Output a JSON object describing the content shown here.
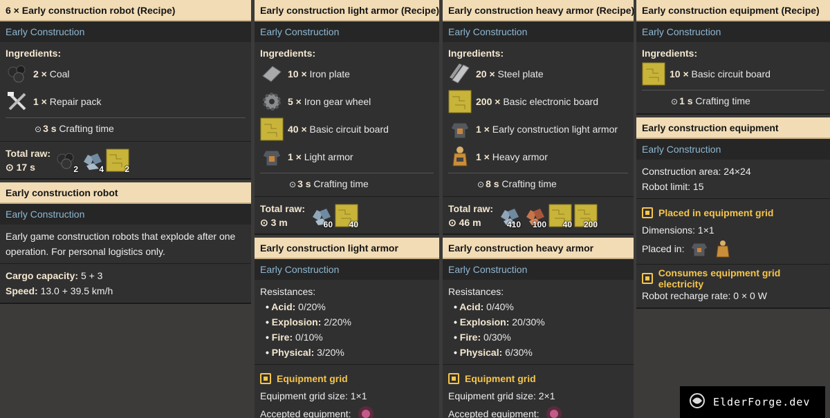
{
  "c1": {
    "recipe_title": "6 × Early construction robot (Recipe)",
    "group": "Early Construction",
    "ingredients_label": "Ingredients:",
    "ingredients": [
      {
        "amount": "2 ×",
        "name": "Coal",
        "icon": "coal-icon"
      },
      {
        "amount": "1 ×",
        "name": "Repair pack",
        "icon": "repair-pack-icon"
      }
    ],
    "time_value": "3 s",
    "time_label": "Crafting time",
    "total_raw_label": "Total raw:",
    "total_time": "17 s",
    "raw": [
      {
        "count": "2",
        "icon": "coal-icon"
      },
      {
        "count": "4",
        "icon": "iron-ore-icon"
      },
      {
        "count": "2",
        "icon": "circuit-board-icon"
      }
    ],
    "item_title": "Early construction robot",
    "item_group": "Early Construction",
    "description": "Early game construction robots that explode after one operation. For personal logistics only.",
    "cargo_label": "Cargo capacity:",
    "cargo_value": "5 + 3",
    "speed_label": "Speed:",
    "speed_value": "13.0 + 39.5  km/h"
  },
  "c2": {
    "recipe_title": "Early construction light armor (Recipe)",
    "group": "Early Construction",
    "ingredients_label": "Ingredients:",
    "ingredients": [
      {
        "amount": "10 ×",
        "name": "Iron plate",
        "icon": "iron-plate-icon"
      },
      {
        "amount": "5 ×",
        "name": "Iron gear wheel",
        "icon": "gear-icon"
      },
      {
        "amount": "40 ×",
        "name": "Basic circuit board",
        "icon": "circuit-board-icon"
      },
      {
        "amount": "1 ×",
        "name": "Light armor",
        "icon": "light-armor-icon"
      }
    ],
    "time_value": "3 s",
    "time_label": "Crafting time",
    "total_raw_label": "Total raw:",
    "total_time": "3 m",
    "raw": [
      {
        "count": "60",
        "icon": "iron-ore-icon"
      },
      {
        "count": "40",
        "icon": "circuit-board-icon"
      }
    ],
    "item_title": "Early construction light armor",
    "item_group": "Early Construction",
    "resist_label": "Resistances:",
    "resist": [
      {
        "k": "Acid:",
        "v": "0/20%"
      },
      {
        "k": "Explosion:",
        "v": "2/20%"
      },
      {
        "k": "Fire:",
        "v": "0/10%"
      },
      {
        "k": "Physical:",
        "v": "3/20%"
      }
    ],
    "grid_head": "Equipment grid",
    "grid_size_label": "Equipment grid size:",
    "grid_size": "1×1",
    "accepted_label": "Accepted equipment:"
  },
  "c3": {
    "recipe_title": "Early construction heavy armor (Recipe)",
    "group": "Early Construction",
    "ingredients_label": "Ingredients:",
    "ingredients": [
      {
        "amount": "20 ×",
        "name": "Steel plate",
        "icon": "steel-plate-icon"
      },
      {
        "amount": "200 ×",
        "name": "Basic electronic board",
        "icon": "circuit-board-icon"
      },
      {
        "amount": "1 ×",
        "name": "Early construction light armor",
        "icon": "light-armor-icon"
      },
      {
        "amount": "1 ×",
        "name": "Heavy armor",
        "icon": "heavy-armor-icon"
      }
    ],
    "time_value": "8 s",
    "time_label": "Crafting time",
    "total_raw_label": "Total raw:",
    "total_time": "46 m",
    "raw": [
      {
        "count": "410",
        "icon": "iron-ore-icon"
      },
      {
        "count": "100",
        "icon": "copper-ore-icon"
      },
      {
        "count": "40",
        "icon": "circuit-board-icon"
      },
      {
        "count": "200",
        "icon": "circuit-board-icon"
      }
    ],
    "item_title": "Early construction heavy armor",
    "item_group": "Early Construction",
    "resist_label": "Resistances:",
    "resist": [
      {
        "k": "Acid:",
        "v": "0/40%"
      },
      {
        "k": "Explosion:",
        "v": "20/30%"
      },
      {
        "k": "Fire:",
        "v": "0/30%"
      },
      {
        "k": "Physical:",
        "v": "6/30%"
      }
    ],
    "grid_head": "Equipment grid",
    "grid_size_label": "Equipment grid size:",
    "grid_size": "2×1",
    "accepted_label": "Accepted equipment:"
  },
  "c4": {
    "recipe_title": "Early construction equipment (Recipe)",
    "group": "Early Construction",
    "ingredients_label": "Ingredients:",
    "ingredients": [
      {
        "amount": "10 ×",
        "name": "Basic circuit board",
        "icon": "circuit-board-icon"
      }
    ],
    "time_value": "1 s",
    "time_label": "Crafting time",
    "item_title": "Early construction equipment",
    "item_group": "Early Construction",
    "area_label": "Construction area:",
    "area_value": "24×24",
    "limit_label": "Robot limit:",
    "limit_value": "15",
    "placed_head": "Placed in equipment grid",
    "dim_label": "Dimensions:",
    "dim_value": "1×1",
    "placed_in_label": "Placed in:",
    "consumes_head": "Consumes equipment grid electricity",
    "recharge_label": "Robot recharge rate:",
    "recharge_value": "0 × 0 W"
  },
  "watermark": "ElderForge.dev"
}
